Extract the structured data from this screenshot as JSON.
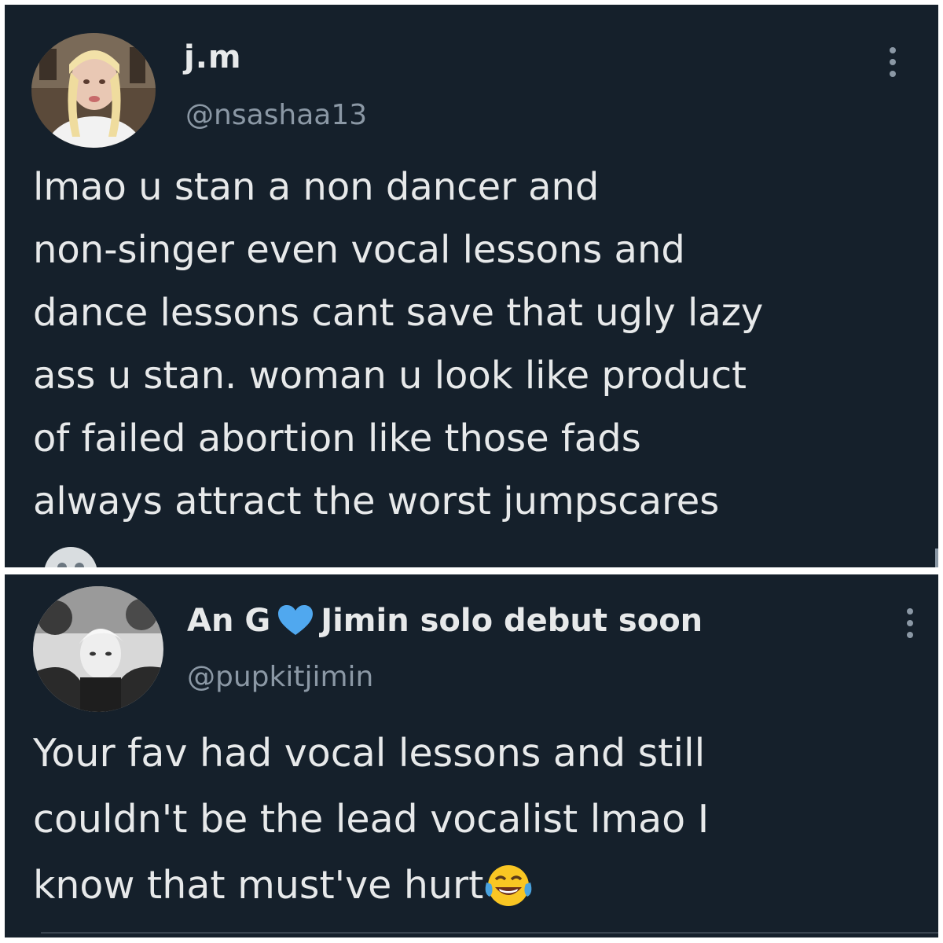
{
  "tweets": [
    {
      "display_name": "j.m",
      "handle": "@nsashaa13",
      "text": "lmao u stan a non dancer and\nnon-singer even vocal lessons and\ndance lessons cant save that ugly lazy\nass u stan. woman u look like product\nof failed abortion like those fads\nalways attract the worst jumpscares"
    },
    {
      "display_name": "An G",
      "name_suffix": "Jimin solo debut soon",
      "handle": "@pupkitjimin",
      "text": "Your fav had vocal lessons and still\ncouldn't be the lead vocalist lmao I\nknow that must've hurt"
    }
  ],
  "colors": {
    "background": "#15202b",
    "primary_text": "#e7e9ea",
    "secondary_text": "#8b98a5",
    "heart": "#50a8ef"
  },
  "icons": {
    "more": "more-vertical-icon",
    "heart": "blue-heart-icon",
    "laughing": "tears-of-joy-emoji",
    "cut_emoji": "cropped-emoji"
  }
}
